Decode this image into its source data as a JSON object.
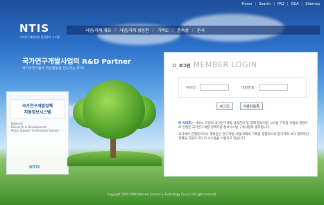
{
  "util_links": [
    "Home",
    "Search",
    "FAQ",
    "Q&A",
    "Sitemap"
  ],
  "logo": {
    "text": "NTIS",
    "subtitle": "국가연구개발사업 종합관리 시스템"
  },
  "nav": [
    "사업/과제 개요",
    "사업/과제 성동편",
    "기여도",
    "종속성",
    "문서"
  ],
  "heading": "국가연구개발사업의 R&D Partner",
  "subheading": "국가과학기술의 혁신활동을 선도하는 NTIS",
  "leftbox": {
    "title_line1": "국가연구개발정책",
    "title_line2": "지원정보시스템",
    "desc_line1": "National",
    "desc_line2": "Research & Development",
    "desc_line3": "Policy Support Information System",
    "mini_logo": "NTIS"
  },
  "login": {
    "header_ko": "로그인",
    "header_en": "MEMBER LOGIN",
    "id_label": "아이디 :",
    "pw_label": "비밀번호 :",
    "id_value": "",
    "pw_value": "",
    "login_button": "로그인",
    "register_button": "사용자등록"
  },
  "description": {
    "highlight": "이 사이트",
    "para1": "는 서비스 지원의 국가연구개발 성과관리 및 정책 정보지원 시스템 구축을 사업의 일환으로 진행된 국가연구개발 정책지원 정보시스템 구축사업의 결과입니다.",
    "para2": "국가에서 진행중이거나 계획중인 연구개발 사업/과제의 기획을 종합적으로 평가하여 보다 합리적인 정책을 지원하고자 이 시스템을 시행하고 있습니다."
  },
  "footer": "Copyright 2002-2006 National Science & Technology Council All right reserved.",
  "colors": {
    "primary": "#1f4f9a",
    "nav_bg": "#14326e"
  }
}
